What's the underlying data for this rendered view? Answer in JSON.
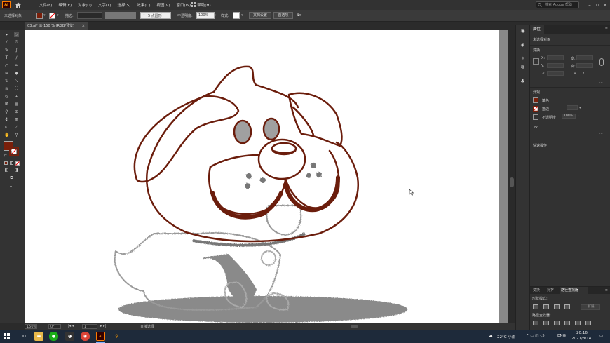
{
  "menubar": {
    "logo": "Ai",
    "items": [
      "文件(F)",
      "编辑(E)",
      "对象(O)",
      "文字(T)",
      "选择(S)",
      "效果(C)",
      "视图(V)",
      "窗口(W)",
      "帮助(H)"
    ],
    "workspace_icon": "grid-icon",
    "search_placeholder": "搜索 Adobe 帮助"
  },
  "controlbar": {
    "selection_status": "未选择对象",
    "stroke_label": "描边:",
    "brush_label": "5 点圆形",
    "opacity_label": "不透明度:",
    "opacity_value": "100%",
    "style_label": "样式:",
    "doc_setup_button": "文档设置",
    "preferences_button": "首选项",
    "fill_color": "#7a1f0a"
  },
  "document_tab": {
    "title": "03.ai* @ 150 % (RGB/预览)",
    "close": "×"
  },
  "statusbar": {
    "zoom": "150%",
    "rotation": "0°",
    "artboard_number": "1",
    "tool_name": "直接选择"
  },
  "properties_panel": {
    "tab": "属性",
    "no_selection": "未选择对象",
    "transform_title": "变换",
    "x_label": "X:",
    "y_label": "Y:",
    "w_label": "宽:",
    "h_label": "高:",
    "angle_label": "⊿:",
    "appearance_title": "外观",
    "fill_label": "填色",
    "stroke_label": "描边",
    "opacity_label": "不透明度",
    "opacity_value": "100%",
    "fx_label": "fx.",
    "quick_actions_title": "快速操作",
    "fill_swatch": "#7a1f0a"
  },
  "pathfinder_panel": {
    "tabs": [
      "变换",
      "对齐",
      "路径查找器"
    ],
    "active_tab": "路径查找器",
    "shape_modes_label": "形状模式:",
    "expand_button": "扩展",
    "pathfinders_label": "路径查找器:"
  },
  "taskbar": {
    "weather": "22°C 小雨",
    "language": "ENG",
    "time": "20:16",
    "date": "2021/8/14"
  },
  "colors": {
    "accent": "#ff7c00",
    "outline": "#6b1d0c",
    "sketch_gray": "#8a8a8a"
  }
}
